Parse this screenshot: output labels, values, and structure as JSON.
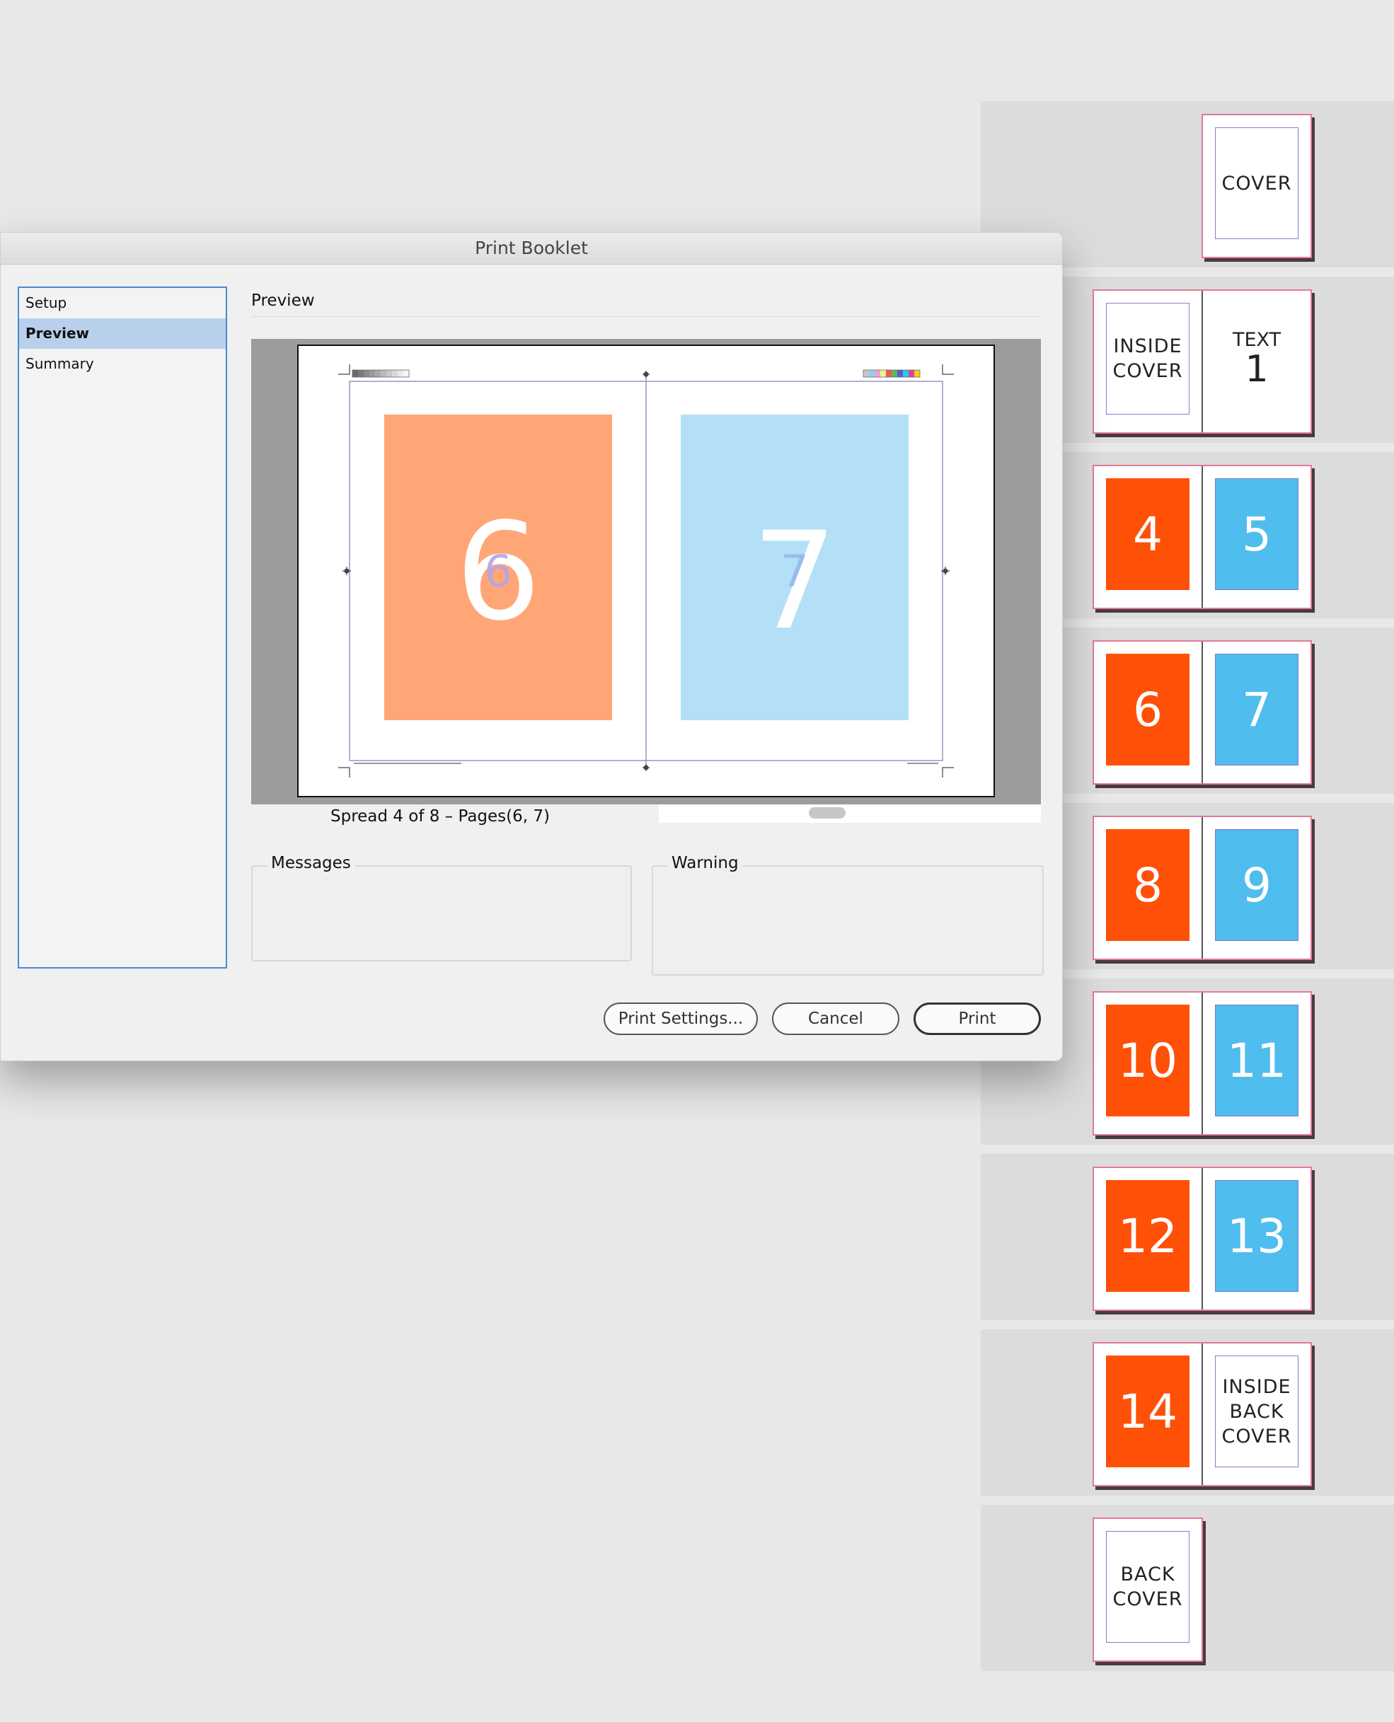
{
  "pages_panel": {
    "spreads": [
      {
        "right": {
          "kind": "white",
          "label": "COVER"
        }
      },
      {
        "left": {
          "kind": "white",
          "label": "INSIDE COVER"
        },
        "right": {
          "kind": "text1",
          "label": "TEXT",
          "number": "1"
        }
      },
      {
        "left": {
          "kind": "orange",
          "label": "4"
        },
        "right": {
          "kind": "blue",
          "label": "5"
        }
      },
      {
        "left": {
          "kind": "orange",
          "label": "6"
        },
        "right": {
          "kind": "blue",
          "label": "7"
        }
      },
      {
        "left": {
          "kind": "orange",
          "label": "8"
        },
        "right": {
          "kind": "blue",
          "label": "9"
        }
      },
      {
        "left": {
          "kind": "orange",
          "label": "10"
        },
        "right": {
          "kind": "blue",
          "label": "11"
        }
      },
      {
        "left": {
          "kind": "orange",
          "label": "12"
        },
        "right": {
          "kind": "blue",
          "label": "13"
        }
      },
      {
        "left": {
          "kind": "orange",
          "label": "14"
        },
        "right": {
          "kind": "white",
          "label": "INSIDE BACK COVER"
        }
      },
      {
        "left": {
          "kind": "white",
          "label": "BACK COVER"
        }
      }
    ],
    "colors": {
      "orange": "#ff5008",
      "blue": "#4fbdee",
      "page_border": "#e07a9a"
    }
  },
  "dialog": {
    "title": "Print Booklet",
    "sidebar": {
      "items": [
        {
          "label": "Setup",
          "active": false
        },
        {
          "label": "Preview",
          "active": true
        },
        {
          "label": "Summary",
          "active": false
        }
      ]
    },
    "section_title": "Preview",
    "preview": {
      "left_page": {
        "number": "6",
        "color": "#ffa677"
      },
      "right_page": {
        "number": "7",
        "color": "#b3e0f6"
      },
      "spread_caption": "Spread 4 of 8 – Pages(6, 7)"
    },
    "messages_label": "Messages",
    "warning_label": "Warning",
    "buttons": {
      "print_settings": "Print Settings...",
      "cancel": "Cancel",
      "print": "Print"
    }
  }
}
